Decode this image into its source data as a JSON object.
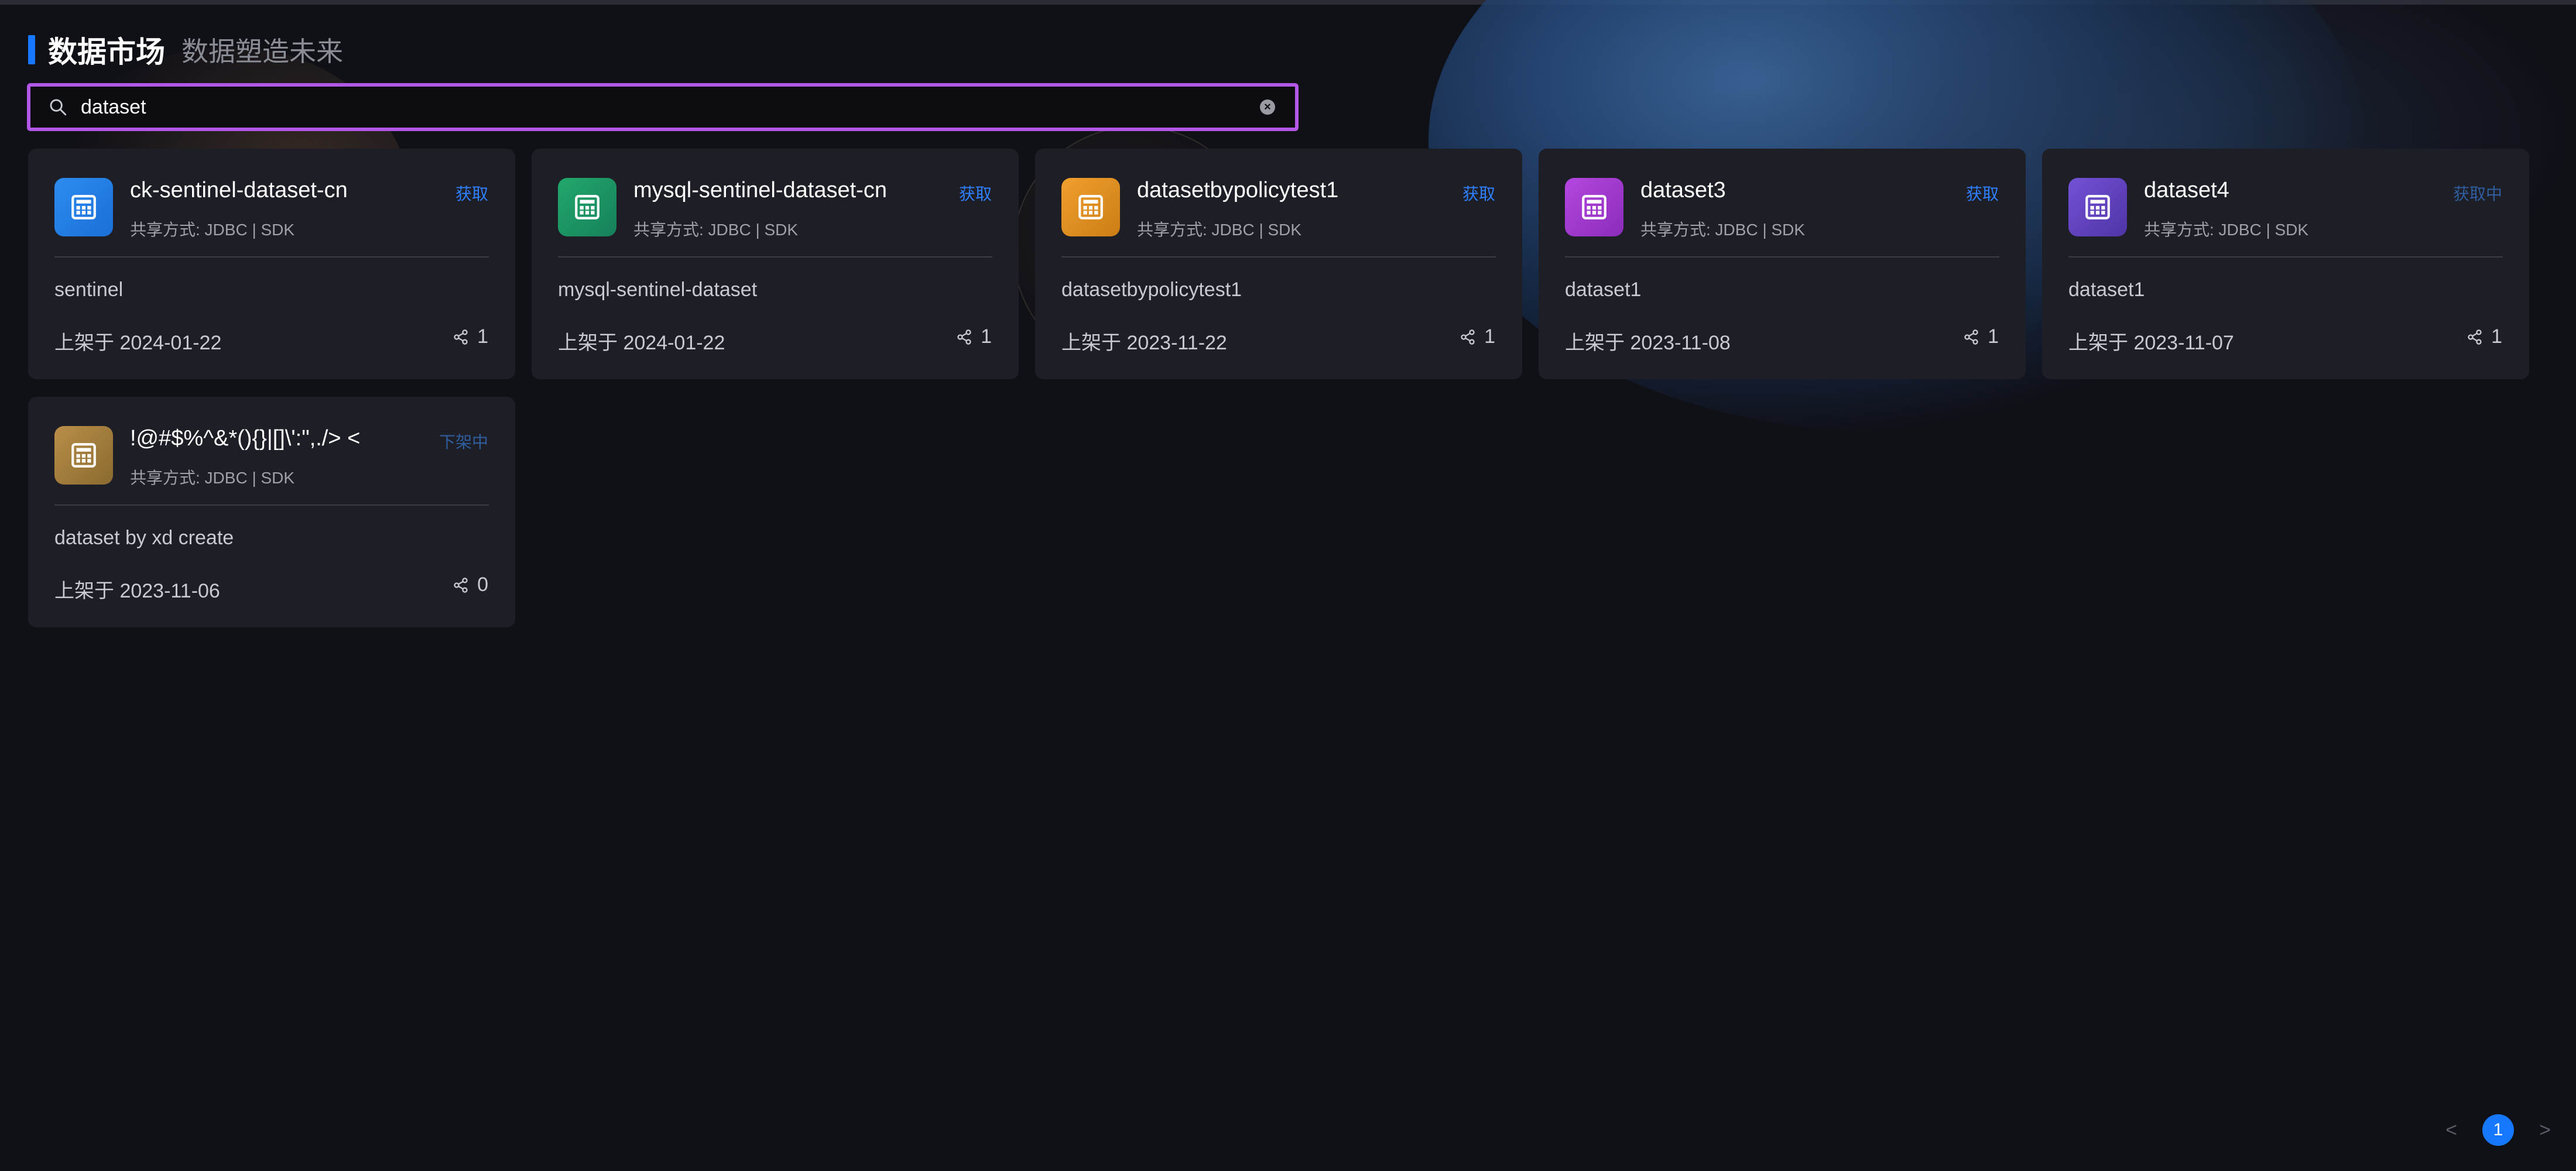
{
  "header": {
    "title": "数据市场",
    "subtitle": "数据塑造未来"
  },
  "search": {
    "value": "dataset",
    "placeholder": ""
  },
  "cards": [
    {
      "name": "ck-sentinel-dataset-cn",
      "share": "共享方式: JDBC | SDK",
      "action": "获取",
      "desc": "sentinel",
      "date": "上架于 2024-01-22",
      "count": "1",
      "color": "#1a6fd6"
    },
    {
      "name": "mysql-sentinel-dataset-cn",
      "share": "共享方式: JDBC | SDK",
      "action": "获取",
      "desc": "mysql-sentinel-dataset",
      "date": "上架于 2024-01-22",
      "count": "1",
      "color": "#19915e"
    },
    {
      "name": "datasetbypolicytest1",
      "share": "共享方式: JDBC | SDK",
      "action": "获取",
      "desc": "datasetbypolicytest1",
      "date": "上架于 2023-11-22",
      "count": "1",
      "color": "#d98a1e"
    },
    {
      "name": "dataset3",
      "share": "共享方式: JDBC | SDK",
      "action": "获取",
      "desc": "dataset1",
      "date": "上架于 2023-11-08",
      "count": "1",
      "color": "#9a35c9"
    },
    {
      "name": "dataset4",
      "share": "共享方式: JDBC | SDK",
      "action": "获取中",
      "desc": "dataset1",
      "date": "上架于 2023-11-07",
      "count": "1",
      "color": "#5e3fb8"
    },
    {
      "name": "!@#$%^&*(){}|[]\\':\",./> <",
      "share": "共享方式: JDBC | SDK",
      "action": "下架中",
      "desc": "dataset by xd create",
      "date": "上架于 2023-11-06",
      "count": "0",
      "color": "#a6803f"
    }
  ],
  "pagination": {
    "prev": "<",
    "current": "1",
    "next": ">"
  },
  "icons": {
    "search": "search-icon",
    "clear": "clear-icon",
    "card": "table-icon",
    "share": "share-icon"
  }
}
